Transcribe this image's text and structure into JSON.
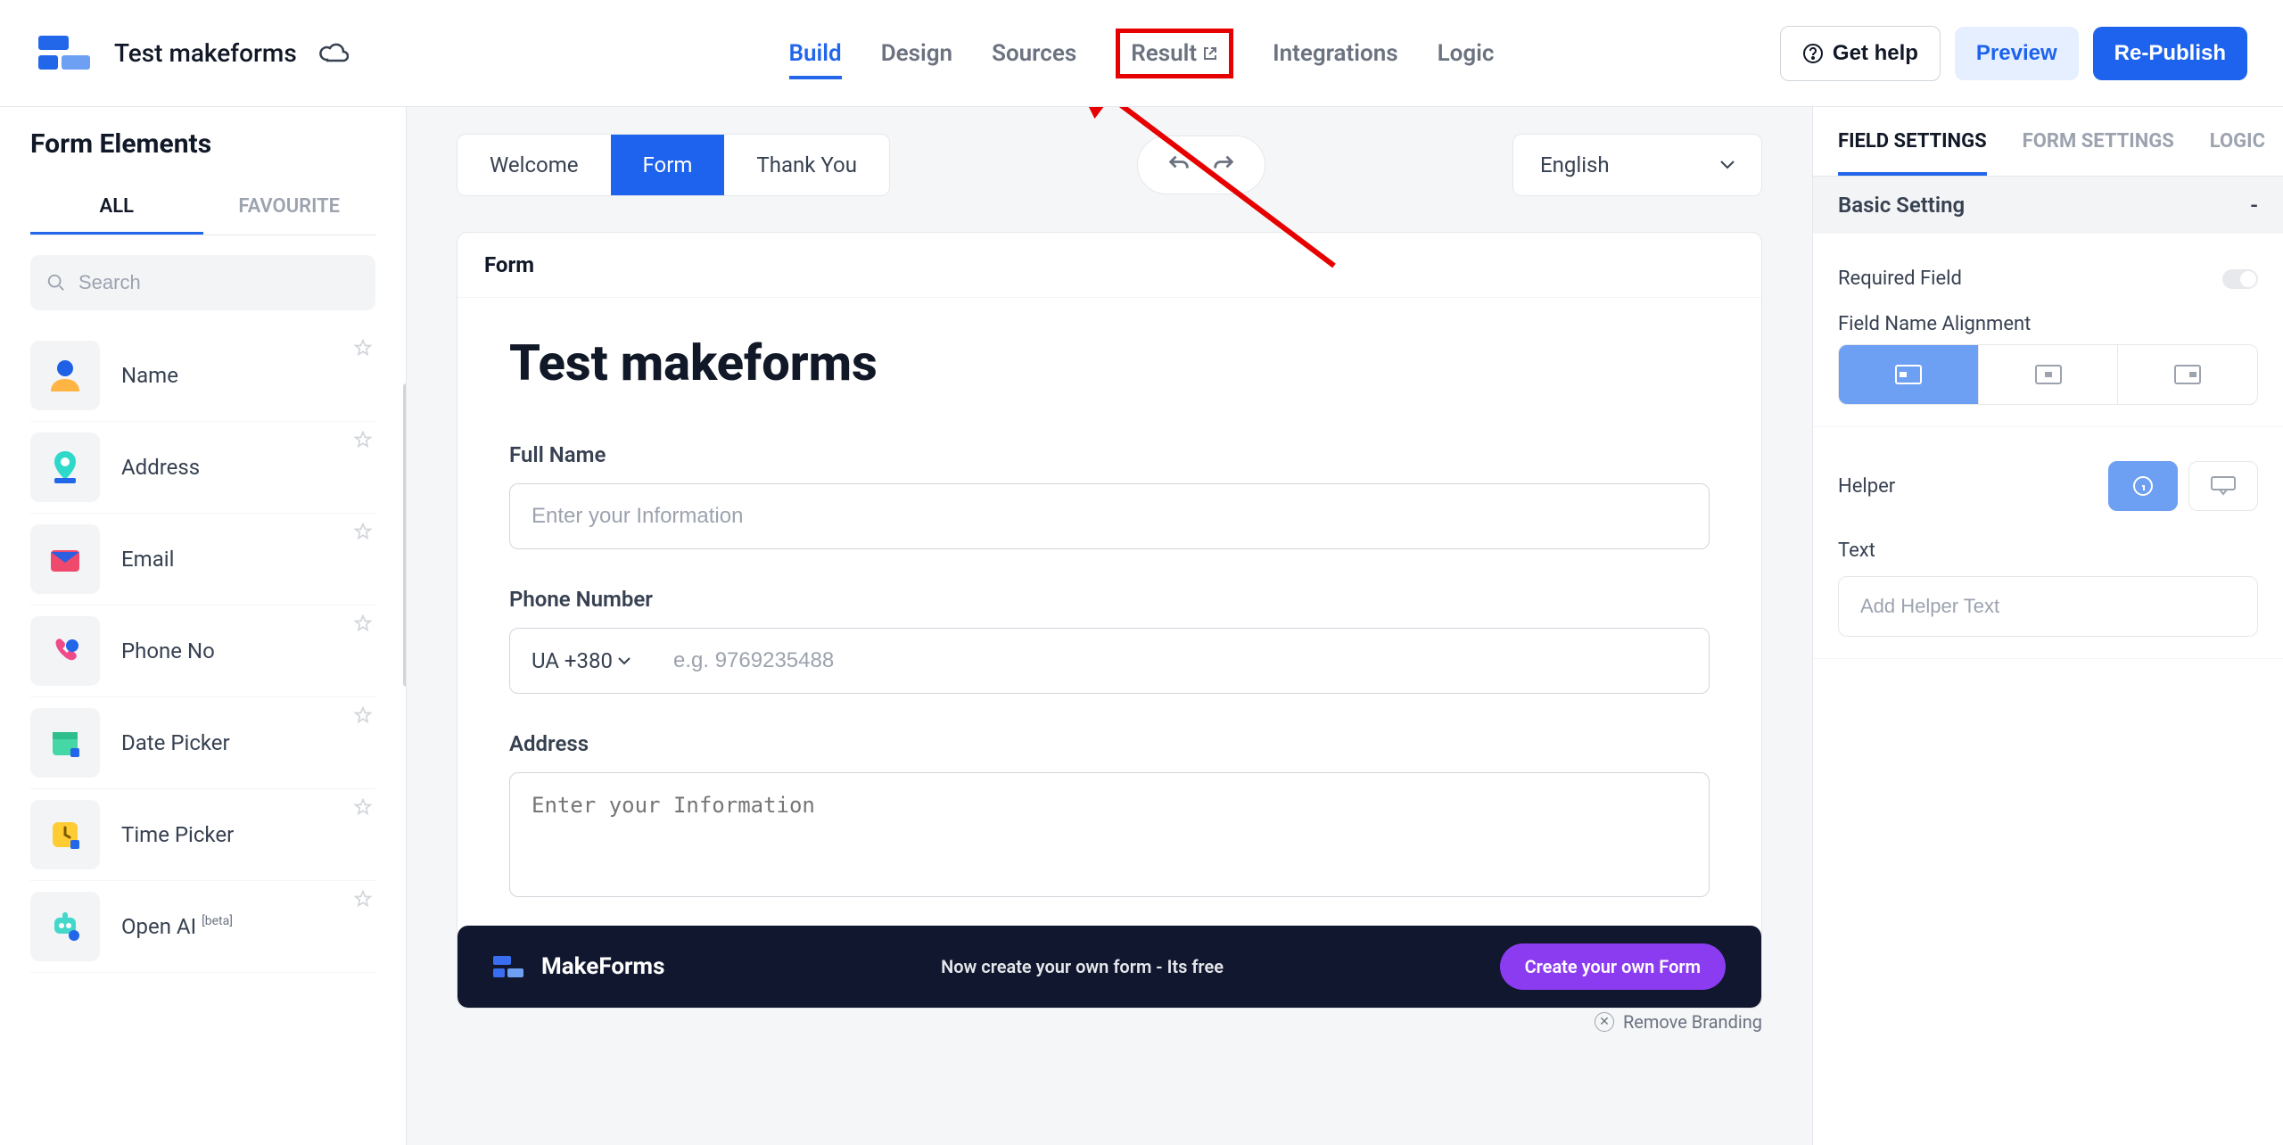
{
  "header": {
    "form_name": "Test makeforms",
    "nav": {
      "build": "Build",
      "design": "Design",
      "sources": "Sources",
      "result": "Result",
      "integrations": "Integrations",
      "logic": "Logic"
    },
    "buttons": {
      "help": "Get help",
      "preview": "Preview",
      "publish": "Re-Publish"
    }
  },
  "sidebar": {
    "title": "Form Elements",
    "tabs": {
      "all": "ALL",
      "favourite": "FAVOURITE"
    },
    "search_placeholder": "Search",
    "elements": [
      {
        "label": "Name"
      },
      {
        "label": "Address"
      },
      {
        "label": "Email"
      },
      {
        "label": "Phone No"
      },
      {
        "label": "Date Picker"
      },
      {
        "label": "Time Picker"
      },
      {
        "label": "Open AI",
        "beta": "[beta]"
      }
    ]
  },
  "canvas": {
    "stages": {
      "welcome": "Welcome",
      "form": "Form",
      "thankyou": "Thank You"
    },
    "language": "English",
    "card_header": "Form",
    "title": "Test makeforms",
    "fields": {
      "fullname": {
        "label": "Full Name",
        "placeholder": "Enter your Information"
      },
      "phone": {
        "label": "Phone Number",
        "cc": "UA +380",
        "placeholder": "e.g. 9769235488"
      },
      "address": {
        "label": "Address",
        "placeholder": "Enter your Information"
      }
    },
    "remove_branding": "Remove Branding",
    "banner": {
      "brand": "MakeForms",
      "tagline": "Now create your own form - Its free",
      "cta": "Create your own Form"
    }
  },
  "right": {
    "tabs": {
      "field": "FIELD SETTINGS",
      "form": "FORM SETTINGS",
      "logic": "LOGIC"
    },
    "basic_setting_label": "Basic Setting",
    "collapse_symbol": "-",
    "required_label": "Required Field",
    "alignment_label": "Field Name Alignment",
    "helper_label": "Helper",
    "text_label": "Text",
    "helper_placeholder": "Add Helper Text"
  }
}
